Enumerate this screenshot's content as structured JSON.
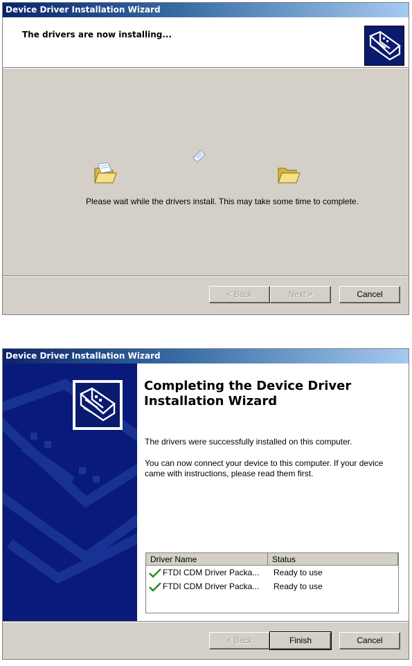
{
  "window1": {
    "title": "Device Driver Installation Wizard",
    "header": "The drivers are now installing...",
    "message": "Please wait while the drivers install. This may take some time to complete.",
    "buttons": {
      "back": "< Back",
      "next": "Next >",
      "cancel": "Cancel"
    }
  },
  "window2": {
    "title": "Device Driver Installation Wizard",
    "heading_line1": "Completing the Device Driver",
    "heading_line2": "Installation Wizard",
    "success_text": "The drivers were successfully installed on this computer.",
    "connect_line1": "You can now connect your device to this computer. If your device",
    "connect_line2": "came with instructions, please read them first.",
    "list": {
      "columns": [
        "Driver Name",
        "Status"
      ],
      "rows": [
        {
          "name": "FTDI CDM Driver Packa...",
          "status": "Ready to use"
        },
        {
          "name": "FTDI CDM Driver Packa...",
          "status": "Ready to use"
        }
      ]
    },
    "buttons": {
      "back": "< Back",
      "finish": "Finish",
      "cancel": "Cancel"
    }
  },
  "colors": {
    "title_start": "#0a246a",
    "title_end": "#a6caf0",
    "side_panel": "#0a1a7a",
    "window_bg": "#d4d0c8",
    "check_green": "#1e8c1e"
  },
  "icons": [
    "wizard-hardware-icon",
    "open-folder-icon",
    "flying-document-icon",
    "checkmark-icon"
  ]
}
